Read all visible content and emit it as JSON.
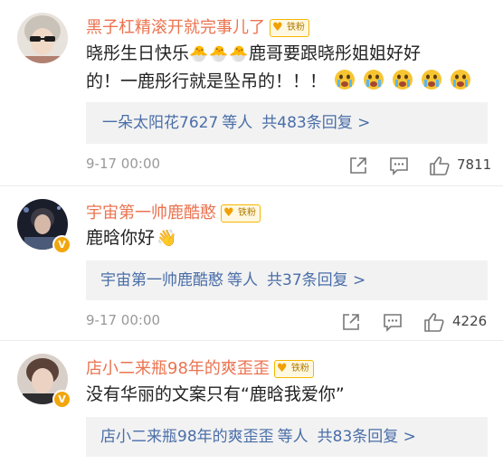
{
  "fan_badge_label": "铁粉",
  "comments": [
    {
      "username": "黑子杠精滚开就完事儿了",
      "text_line1_a": "晓彤生日快乐",
      "chick_emoji": "🐣",
      "text_line1_b": "鹿哥要跟晓彤姐姐好好",
      "text_line2": "的！一鹿彤行就是坠吊的！！！",
      "reply_users": "一朵太阳花7627",
      "reply_suffix": "等人",
      "reply_total": "共483条回复 >",
      "time": "9-17 00:00",
      "likes": "7811"
    },
    {
      "username": "宇宙第一帅鹿酷憨",
      "text": "鹿晗你好",
      "wave_emoji": "👋",
      "reply_users": "宇宙第一帅鹿酷憨",
      "reply_suffix": "等人",
      "reply_total": "共37条回复 >",
      "time": "9-17 00:00",
      "likes": "4226",
      "verified_badge": "V"
    },
    {
      "username": "店小二来瓶98年的爽歪歪",
      "text": "没有华丽的文案只有“鹿晗我爱你”",
      "reply_users": "店小二来瓶98年的爽歪歪",
      "reply_suffix": "等人",
      "reply_total": "共83条回复 >",
      "verified_badge": "V"
    }
  ],
  "icons": {
    "share": "share-icon",
    "comment": "comment-icon",
    "like": "like-icon"
  },
  "colors": {
    "username": "#eb7350",
    "link": "#4a6ea8",
    "time": "#999999",
    "reply_bg": "#f2f2f2",
    "badge": "#f5b700"
  }
}
